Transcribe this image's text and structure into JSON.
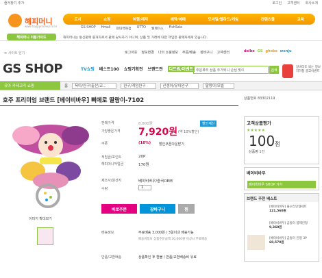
{
  "topbar": {
    "fav": "즐겨찾기 추가",
    "links": [
      "로그인",
      "고객센터",
      "회사소개"
    ]
  },
  "hm": {
    "logo": "해피머니",
    "url": "www.happymoney.co.kr",
    "nav": [
      "도서",
      "쇼핑",
      "여행/레저",
      "예약/예매",
      "모바일/웹하드/게임",
      "컨텐츠몰",
      "교육"
    ],
    "sub": [
      "GS SHOP",
      "Hmall",
      "현대백화점",
      "OTTO",
      "웰페이스",
      "FishSale"
    ],
    "notice_tag": "해피머니 이용가이드",
    "notice_msg": "해피머니는 통신판매 중개자로서 판매 당사자가 아니며, 상품 및 거래에 대한 책임은 판매자에게 있습니다."
  },
  "gs": {
    "util_left": "≡ 사이트 닫기",
    "util": [
      "로그아웃",
      "정보변경",
      "나의 쇼핑정보",
      "주문/배송",
      "장바구니",
      "고객센터"
    ],
    "brands": [
      "dolbo",
      "GS",
      "ghoko",
      "wonju"
    ],
    "logo": "GS SHOP",
    "tabs": [
      "TV쇼핑",
      "베스트100",
      "쇼핑기획전",
      "브랜드관",
      "디드림/이벤트"
    ],
    "search_ph": "주문폭주 상품 추가되니 손님 맞이",
    "search_btn": "검색",
    "ad": "알바라도 되는 정보 지하철 광고이벤트"
  },
  "cat": {
    "label": "유아 카테고리 쇼핑",
    "crumbs": [
      "홈",
      "육아/완구/출산/교...",
      "완구/게임완구",
      "신생아/유아완구",
      "딸랑이/모빌"
    ]
  },
  "product": {
    "title": "호주 프리미엄 브랜드 [베이비바우] 삐에로 딸랑이-7102",
    "no_label": "상품번호",
    "no": "83302119",
    "list_label": "판매가격",
    "list_price": "8,800원",
    "sale_label": "가장좋은가격",
    "sale_price": "7,920원",
    "sale_pct": "(약 10%할인)",
    "calc": "할인계산",
    "coupon_label": "쿠폰",
    "coupon": "(10%)",
    "coupon_link": "할인쿠폰다운받기",
    "point_label": "적립금/포인트",
    "point": "20P",
    "gift_label": "해피머니적립금",
    "gift": "170원",
    "maker_label": "제조사/원산지",
    "maker": "베이비바우/중국OEM",
    "qty_label": "수량",
    "qty": "1",
    "btn_buy": "바로주문",
    "btn_cart": "장바구니",
    "btn_wish": "찜",
    "ship_label": "배송정보",
    "ship": "무료배송 3,000원 / 3일이내 배송가능",
    "ship2": "배송비정보 상품주문금액 30,000원 이상시 무료배송",
    "return_label": "반품/교환배송",
    "return": "상품확인 후 환불 / 반품/교환배송비 유료",
    "zoom": "이미지 확대보기"
  },
  "side": {
    "rating_title": "고객상품평가",
    "score": "100",
    "unit": "점",
    "review": "상품평 1건",
    "brand_title": "베이비바우",
    "brand_link": "베이비바우 SHOP 가기",
    "best_title": "브랜드 추천 베스트",
    "item1": "[베이비바우] 물오리인형세트",
    "price1": "121,560원",
    "item2": "[베이비바우] 곰돌이 봉제인형",
    "price2": "9,360원",
    "item3": "[베이비바우] 곰돌이 인형 3P",
    "price3": "60,570원"
  }
}
